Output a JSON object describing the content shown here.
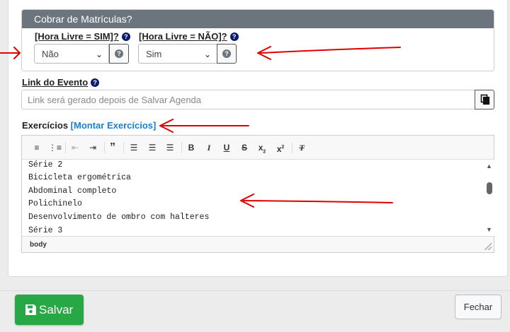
{
  "panel": {
    "title": "Cobrar de Matrículas?",
    "hora_livre_sim": {
      "label": "[Hora Livre = SIM]?",
      "selected": "Não"
    },
    "hora_livre_nao": {
      "label": "[Hora Livre = NÃO]?",
      "selected": "Sim"
    }
  },
  "link_evento": {
    "label": "Link do Evento",
    "placeholder": "Link será gerado depois de Salvar Agenda"
  },
  "exercicios": {
    "label": "Exercícios",
    "montar_link": "[Montar Exercícios]",
    "lines": [
      "Série 2",
      "Bicicleta ergométrica",
      "Abdominal completo",
      "Polichinelo",
      "Desenvolvimento de ombro com halteres",
      "Série 3"
    ],
    "path": "body"
  },
  "toolbar_icons": [
    "numbered-list-icon",
    "bullet-list-icon",
    "outdent-icon",
    "indent-icon",
    "blockquote-icon",
    "align-left-icon",
    "align-center-icon",
    "align-right-icon",
    "bold-icon",
    "italic-icon",
    "underline-icon",
    "strikethrough-icon",
    "subscript-icon",
    "superscript-icon",
    "remove-format-icon"
  ],
  "footer": {
    "save_label": "Salvar",
    "close_label": "Fechar"
  },
  "colors": {
    "save": "#28a745",
    "panel_header": "#6c757d",
    "link": "#1a7fd4",
    "annotation": "#e00000"
  }
}
